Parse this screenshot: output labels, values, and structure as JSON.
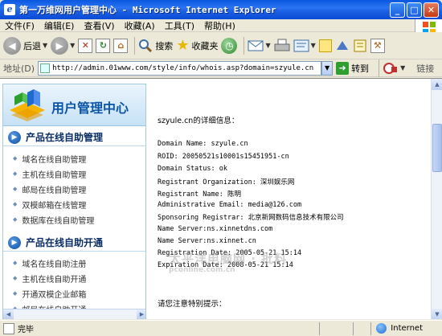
{
  "window": {
    "title": "第一万维网用户管理中心 - Microsoft Internet Explorer",
    "app_icon": "ie-icon"
  },
  "menu": [
    "文件(F)",
    "编辑(E)",
    "查看(V)",
    "收藏(A)",
    "工具(T)",
    "帮助(H)"
  ],
  "toolbar": {
    "back_label": "后退",
    "search_label": "搜索",
    "favorites_label": "收藏夹"
  },
  "address": {
    "label": "地址(D)",
    "url": "http://admin.01www.com/style/info/whois.asp?domain=szyule.cn",
    "go_label": "转到",
    "links_label": "链接"
  },
  "sidebar": {
    "logo_title": "用户管理中心",
    "section1": {
      "title": "产品在线自助管理",
      "items": [
        "域名在线自助管理",
        "主机在线自助管理",
        "邮局在线自助管理",
        "双模邮箱在线管理",
        "数据库在线自助管理"
      ]
    },
    "section2": {
      "title": "产品在线自助开通",
      "items": [
        "域名在线自助注册",
        "主机在线自助开通",
        "开通双模企业邮箱",
        "邮局在线自助开通"
      ]
    }
  },
  "whois": {
    "heading": "szyule.cn的详细信息：",
    "lines": [
      "Domain Name: szyule.cn",
      "ROID: 20050521s10001s15451951-cn",
      "Domain Status: ok",
      "Registrant Organization: 深圳娱乐网",
      "Registrant Name: 陈明",
      "Administrative Email: media@126.com",
      "Sponsoring Registrar: 北京新网数码信息技术有限公司",
      "Name Server:ns.xinnetdns.com",
      "Name Server:ns.xinnet.cn",
      "Registration Date: 2005-05-21 15:14",
      "Expiration Date: 2008-05-21 15:14"
    ],
    "notice": "请您注意特别提示："
  },
  "watermark": {
    "line1": "太平洋电脑网 · 批料",
    "line2": "pconline.com.cn"
  },
  "status": {
    "text": "完毕",
    "zone": "Internet"
  },
  "colors": {
    "titlebar": "#0A58E0",
    "sidebar_title": "#0B55A8",
    "section_title": "#0A2E66"
  }
}
